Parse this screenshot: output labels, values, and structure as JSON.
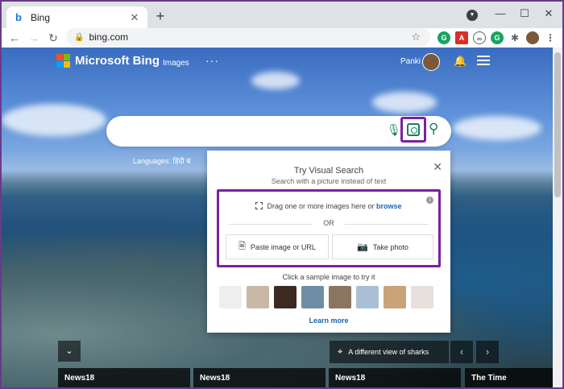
{
  "browser": {
    "tab_title": "Bing",
    "tab_close": "✕",
    "new_tab": "+",
    "url": "bing.com",
    "win_minimize": "—",
    "win_maximize": "☐",
    "win_close": "✕"
  },
  "bing": {
    "brand": "Microsoft Bing",
    "nav_images": "Images",
    "more": "···",
    "user_name": "Panki",
    "languages_label": "Languages: हिंदी  बं"
  },
  "visual_search": {
    "title": "Try Visual Search",
    "subtitle": "Search with a picture instead of text",
    "drop_text": "Drag one or more images here or ",
    "browse": "browse",
    "or": "OR",
    "paste_label": "Paste image or URL",
    "photo_label": "Take photo",
    "sample_label": "Click a sample image to try it",
    "learn_more": "Learn more"
  },
  "bottom": {
    "caption": "A different view of sharks",
    "news": [
      "News18",
      "News18",
      "News18",
      "The Time"
    ]
  },
  "colors": {
    "accent_purple": "#7b1fa2",
    "bing_green": "#1a7d5e",
    "link_blue": "#1a65b0"
  }
}
